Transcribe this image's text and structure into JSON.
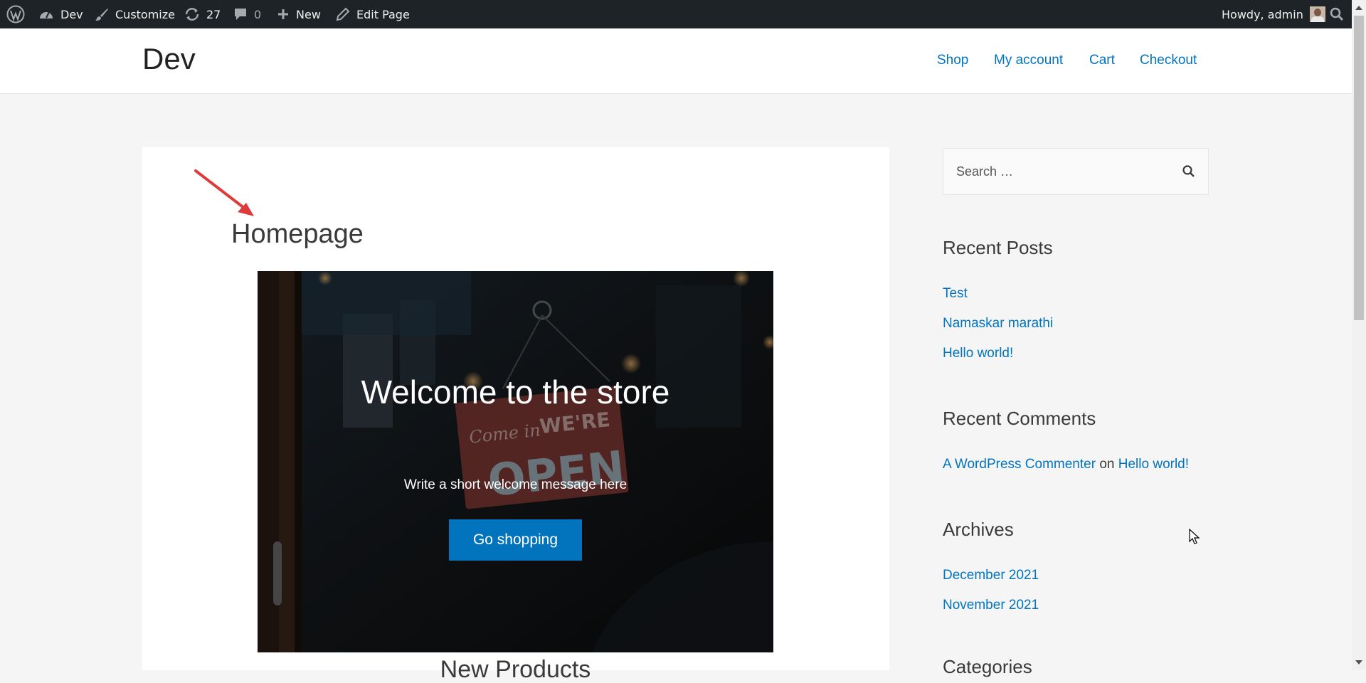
{
  "admin_bar": {
    "site_name": "Dev",
    "customize": "Customize",
    "updates_count": "27",
    "comments_count": "0",
    "new_label": "New",
    "edit_page": "Edit Page",
    "howdy": "Howdy, admin"
  },
  "header": {
    "site_title": "Dev",
    "nav": [
      "Shop",
      "My account",
      "Cart",
      "Checkout"
    ]
  },
  "main": {
    "page_title": "Homepage",
    "hero": {
      "title": "Welcome to the store",
      "subtitle": "Write a short welcome message here",
      "button": "Go shopping",
      "sign_text_1": "Come in",
      "sign_text_2": "WE'RE",
      "sign_text_3": "OPEN"
    },
    "section_heading": "New Products"
  },
  "sidebar": {
    "search_placeholder": "Search …",
    "recent_posts_title": "Recent Posts",
    "recent_posts": [
      "Test",
      "Namaskar marathi",
      "Hello world!"
    ],
    "recent_comments_title": "Recent Comments",
    "comment": {
      "author": "A WordPress Commenter",
      "on": "on",
      "post": "Hello world!"
    },
    "archives_title": "Archives",
    "archives": [
      "December 2021",
      "November 2021"
    ],
    "categories_title": "Categories"
  },
  "colors": {
    "admin_bar_bg": "#1d2327",
    "link": "#0274be",
    "button": "#0274be",
    "page_bg": "#f5f5f5",
    "annotation_arrow": "#e03b3b"
  },
  "icons": [
    "wordpress-icon",
    "dashboard-icon",
    "paintbrush-icon",
    "updates-icon",
    "comment-icon",
    "plus-icon",
    "pencil-icon",
    "admin-search-icon",
    "search-icon",
    "mouse-cursor-icon"
  ]
}
